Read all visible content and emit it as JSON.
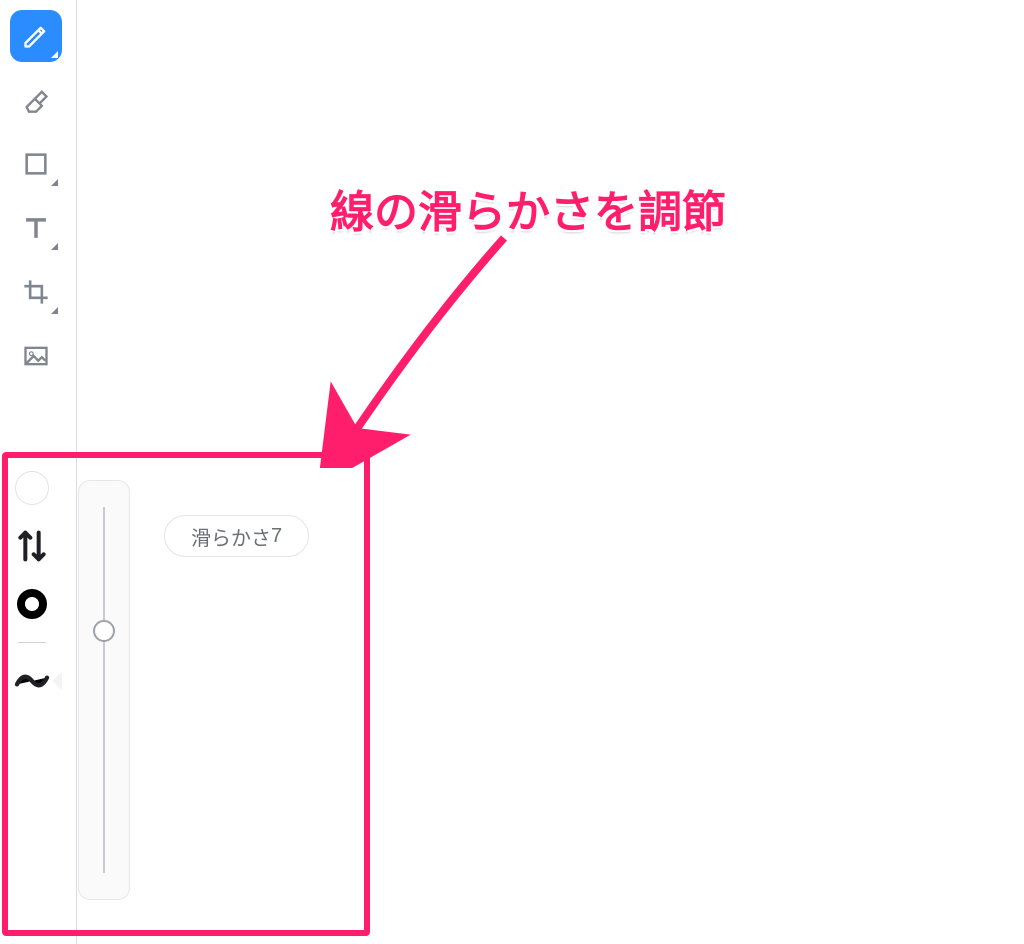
{
  "toolbar": {
    "items": [
      {
        "id": "pen",
        "name": "pen-tool-button",
        "icon": "pencil-icon",
        "active": true,
        "hasSubmenu": true
      },
      {
        "id": "eraser",
        "name": "eraser-tool-button",
        "icon": "eraser-icon",
        "active": false,
        "hasSubmenu": false
      },
      {
        "id": "shape",
        "name": "shape-tool-button",
        "icon": "square-icon",
        "active": false,
        "hasSubmenu": true
      },
      {
        "id": "text",
        "name": "text-tool-button",
        "icon": "text-icon",
        "active": false,
        "hasSubmenu": true
      },
      {
        "id": "crop",
        "name": "crop-tool-button",
        "icon": "crop-icon",
        "active": false,
        "hasSubmenu": true
      },
      {
        "id": "image",
        "name": "image-tool-button",
        "icon": "image-icon",
        "active": false,
        "hasSubmenu": false
      }
    ]
  },
  "submenu": {
    "items": [
      {
        "id": "color",
        "name": "color-swatch-button",
        "icon": "circle-empty"
      },
      {
        "id": "swap",
        "name": "swap-direction-button",
        "icon": "arrows-icon"
      },
      {
        "id": "thickness",
        "name": "stroke-thickness-button",
        "icon": "ring-icon"
      },
      {
        "id": "smooth",
        "name": "line-smoothness-button",
        "icon": "wave-icon"
      }
    ]
  },
  "slider": {
    "label": "滑らかさ",
    "value": 7,
    "min": 0,
    "max": 10,
    "thumb_percent_from_top": 34
  },
  "annotation": {
    "headline": "線の滑らかさを調節",
    "highlight_color": "#ff1e6b"
  }
}
